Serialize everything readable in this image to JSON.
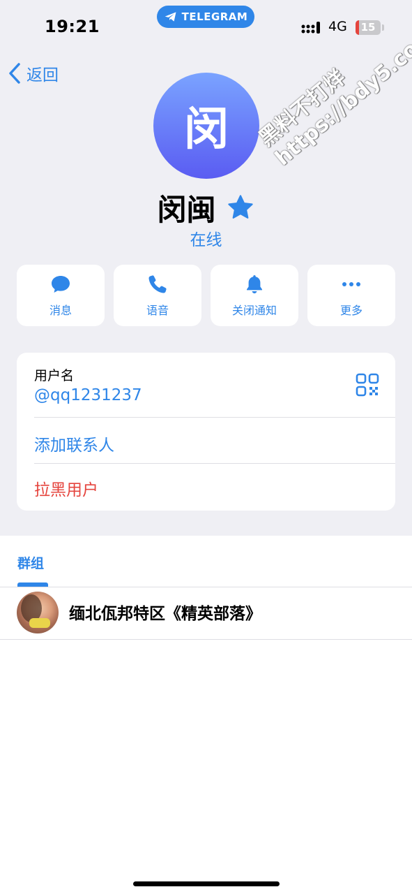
{
  "status_bar": {
    "time": "19:21",
    "pill_label": "TELEGRAM",
    "network": "4G",
    "battery": "15",
    "battery_level": 0.15
  },
  "nav": {
    "back_label": "返回"
  },
  "profile": {
    "avatar_letter": "闵",
    "name": "闵闽",
    "status": "在线"
  },
  "actions": [
    {
      "label": "消息",
      "icon": "message-icon"
    },
    {
      "label": "语音",
      "icon": "phone-icon"
    },
    {
      "label": "关闭通知",
      "icon": "bell-icon"
    },
    {
      "label": "更多",
      "icon": "more-icon"
    }
  ],
  "info": {
    "username_label": "用户名",
    "username_value": "@qq1231237",
    "add_contact": "添加联系人",
    "block_user": "拉黑用户"
  },
  "groups": {
    "tab_label": "群组",
    "items": [
      {
        "name": "缅北佤邦特区《精英部落》"
      }
    ]
  },
  "watermark": {
    "line1": "黑料不打烊",
    "line2": "https://bdy5.co"
  },
  "colors": {
    "accent": "#2f86e8",
    "destructive": "#e5443d",
    "background": "#efeff4"
  }
}
